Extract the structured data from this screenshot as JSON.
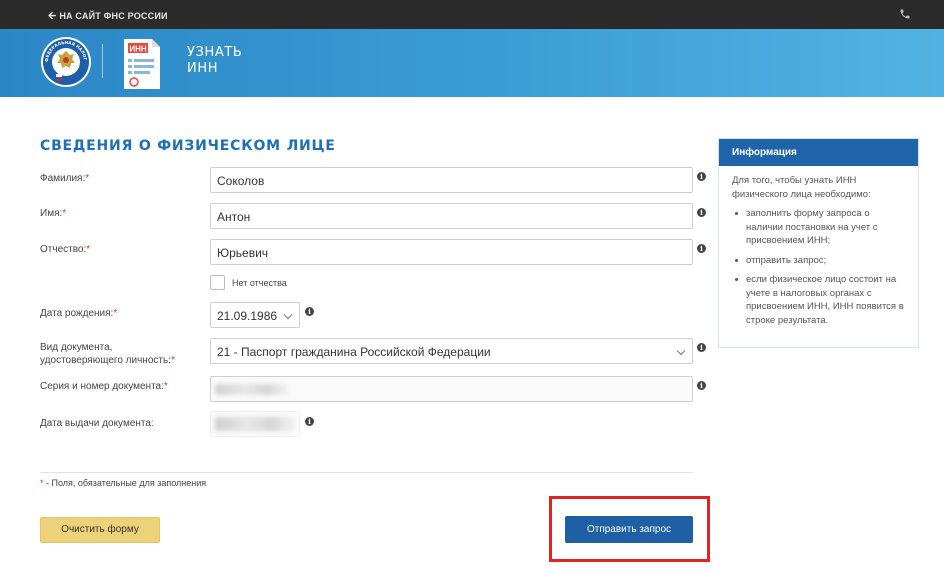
{
  "topbar": {
    "back_label": "НА САЙТ ФНС РОССИИ",
    "back_icon": "arrow-left-icon",
    "phone_icon": "phone-icon"
  },
  "banner": {
    "logo_name": "fns-emblem",
    "logo_text": "ФЕДЕРАЛЬНАЯ НАЛОГОВАЯ СЛУЖБА",
    "doc_icon_text": "ИНН",
    "title_line1": "УЗНАТЬ",
    "title_line2": "ИНН"
  },
  "form": {
    "title": "СВЕДЕНИЯ О ФИЗИЧЕСКОМ ЛИЦЕ",
    "required_mark": "*",
    "fields": {
      "surname": {
        "label": "Фамилия:",
        "value": "Соколов"
      },
      "name": {
        "label": "Имя:",
        "value": "Антон"
      },
      "patronymic": {
        "label": "Отчество:",
        "value": "Юрьевич"
      },
      "no_patronymic": {
        "label": "Нет отчества",
        "checked": false
      },
      "birth_date": {
        "label": "Дата рождения:",
        "value": "21.09.1986"
      },
      "doc_type": {
        "label_line1": "Вид документа,",
        "label_line2": "удостоверяющего личность:",
        "value": "21 - Паспорт гражданина Российской Федерации"
      },
      "doc_number": {
        "label": "Серия и номер документа:",
        "value": ""
      },
      "issue_date": {
        "label": "Дата выдачи документа:",
        "value": ""
      }
    },
    "required_note": "- Поля, обязательные для заполнения",
    "clear_button": "Очистить форму",
    "submit_button": "Отправить запрос"
  },
  "info": {
    "heading": "Информация",
    "intro": "Для того, чтобы узнать ИНН физического лица необходимо:",
    "items": [
      "заполнить форму запроса о наличии постановки на учет с присвоением ИНН;",
      "отправить запрос;",
      "если физическое лицо состоит на учете в налоговых органах с присвоением ИНН, ИНН появится в строке результата."
    ]
  },
  "colors": {
    "topbar": "#2b2b2b",
    "banner": "#3b9ed6",
    "accent": "#1f5fa5",
    "title": "#1d6fb8",
    "required": "#e0322a",
    "clear_button": "#eed27a",
    "highlight": "#e52222"
  }
}
